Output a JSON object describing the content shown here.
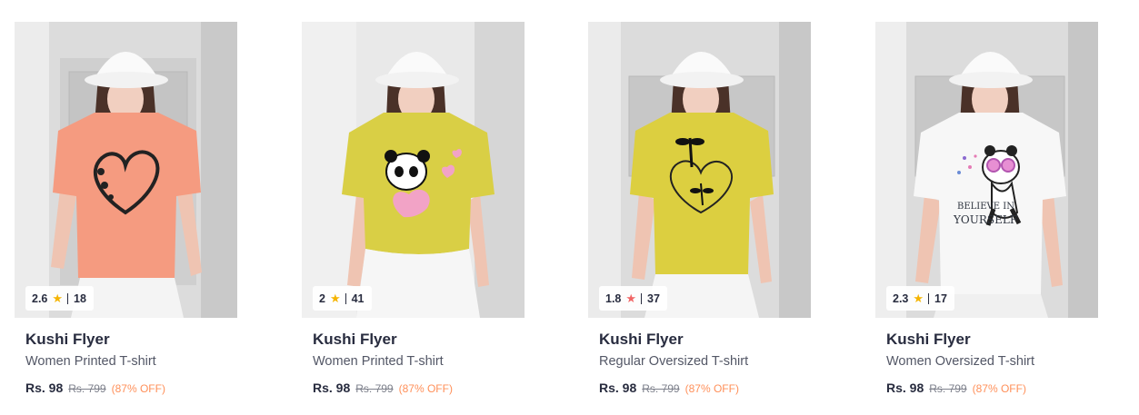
{
  "products": [
    {
      "brand": "Kushi Flyer",
      "title": "Women Printed T-shirt",
      "rating": "2.6",
      "rating_count": "18",
      "star_color": "#f5b400",
      "price": "Rs. 98",
      "mrp": "Rs. 799",
      "discount": "(87% OFF)",
      "shirt_color": "#f59b80",
      "graphic": "heart-butterfly-icon"
    },
    {
      "brand": "Kushi Flyer",
      "title": "Women Printed T-shirt",
      "rating": "2",
      "rating_count": "41",
      "star_color": "#f5b400",
      "price": "Rs. 98",
      "mrp": "Rs. 799",
      "discount": "(87% OFF)",
      "shirt_color": "#d9cf45",
      "graphic": "panda-heart-icon"
    },
    {
      "brand": "Kushi Flyer",
      "title": "Regular Oversized T-shirt",
      "rating": "1.8",
      "rating_count": "37",
      "star_color": "#f16565",
      "price": "Rs. 98",
      "mrp": "Rs. 799",
      "discount": "(87% OFF)",
      "shirt_color": "#dccf40",
      "graphic": "heart-dragonfly-icon"
    },
    {
      "brand": "Kushi Flyer",
      "title": "Women Oversized T-shirt",
      "rating": "2.3",
      "rating_count": "17",
      "star_color": "#f5b400",
      "price": "Rs. 98",
      "mrp": "Rs. 799",
      "discount": "(87% OFF)",
      "shirt_color": "#f7f7f7",
      "graphic": "panda-believe-icon",
      "graphic_text_1": "BELIEVE IN",
      "graphic_text_2": "YOURSELF"
    }
  ]
}
